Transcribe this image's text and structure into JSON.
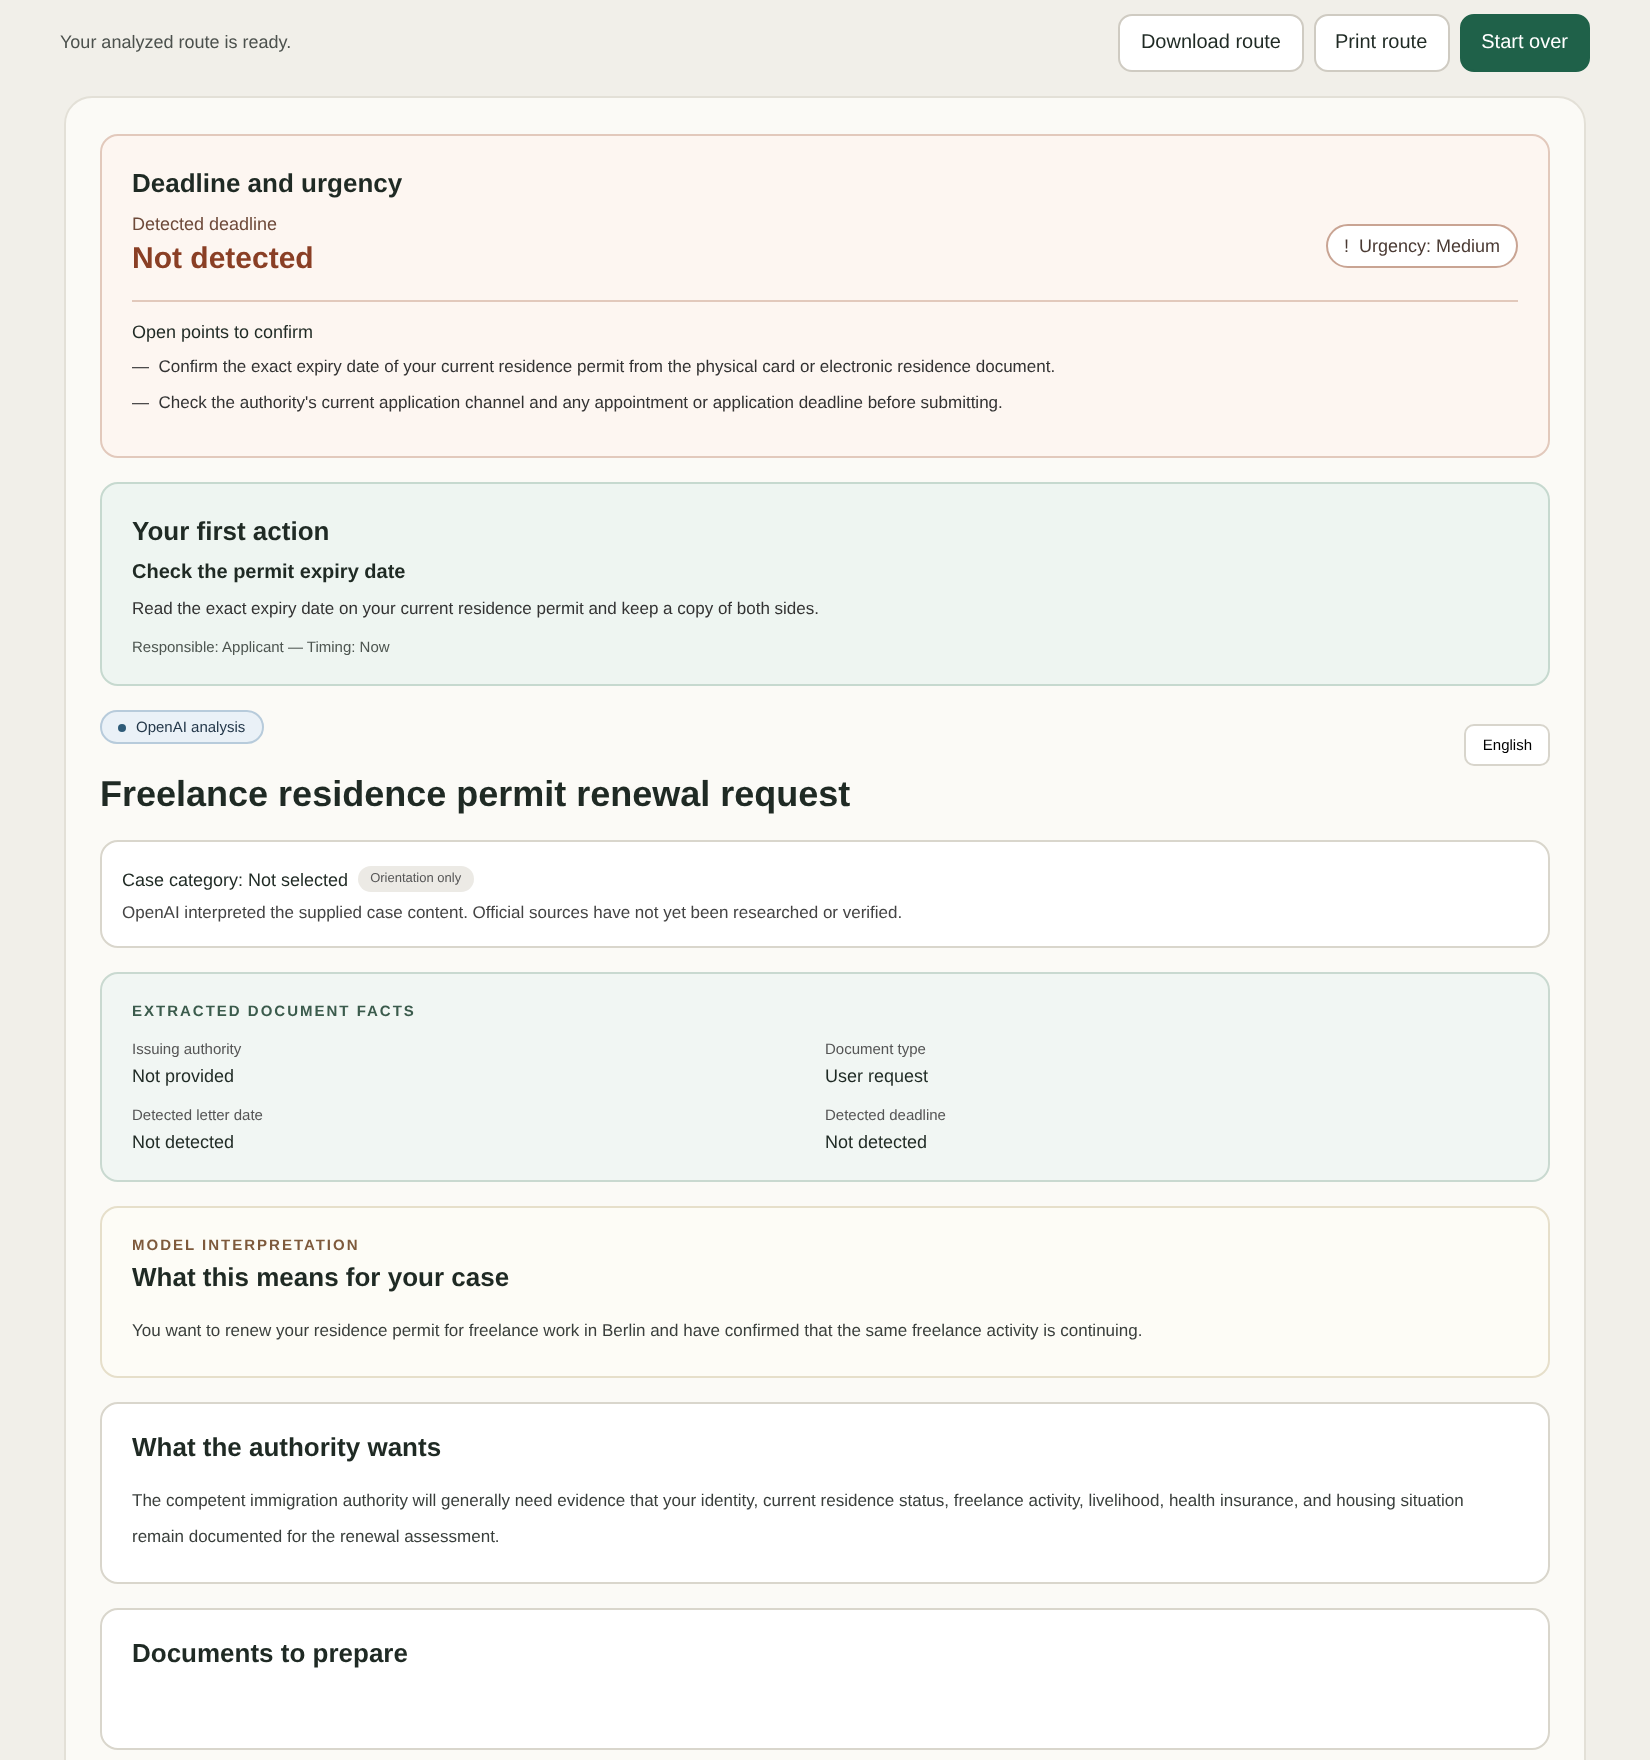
{
  "top_bar": {
    "status": "Your analyzed route is ready.",
    "buttons": [
      {
        "label": "Download route",
        "kind": "secondary"
      },
      {
        "label": "Print route",
        "kind": "secondary"
      },
      {
        "label": "Start over",
        "kind": "primary"
      }
    ]
  },
  "deadline": {
    "title": "Deadline and urgency",
    "label": "Detected deadline",
    "value": "Not detected",
    "urgency": {
      "icon": "!",
      "label": "Urgency: Medium"
    },
    "open_points_title": "Open points to confirm",
    "open_points": [
      {
        "bullet": "—",
        "text": "Confirm the exact expiry date of your current residence permit from the physical card or electronic residence document."
      },
      {
        "bullet": "—",
        "text": "Check the authority's current application channel and any appointment or application deadline before submitting."
      }
    ]
  },
  "first_action": {
    "title": "Your first action",
    "action": "Check the permit expiry date",
    "description": "Read the exact expiry date on your current residence permit and keep a copy of both sides.",
    "meta": "Responsible: Applicant — Timing: Now"
  },
  "analysis_badge": "OpenAI analysis",
  "language": "English",
  "case_title": "Freelance residence permit renewal request",
  "category": {
    "label": "Case category: Not selected",
    "badge": "Orientation only",
    "note": "OpenAI interpreted the supplied case content. Official sources have not yet been researched or verified."
  },
  "facts": {
    "title": "EXTRACTED DOCUMENT FACTS",
    "items": [
      {
        "label": "Issuing authority",
        "value": "Not provided"
      },
      {
        "label": "Document type",
        "value": "User request"
      },
      {
        "label": "Detected letter date",
        "value": "Not detected"
      },
      {
        "label": "Detected deadline",
        "value": "Not detected"
      }
    ]
  },
  "interpretation": {
    "eyebrow": "MODEL INTERPRETATION",
    "title": "What this means for your case",
    "text": "You want to renew your residence permit for freelance work in Berlin and have confirmed that the same freelance activity is continuing."
  },
  "authority": {
    "title": "What the authority wants",
    "text": "The competent immigration authority will generally need evidence that your identity, current residence status, freelance activity, livelihood, health insurance, and housing situation remain documented for the renewal assessment."
  },
  "documents": {
    "title": "Documents to prepare"
  }
}
